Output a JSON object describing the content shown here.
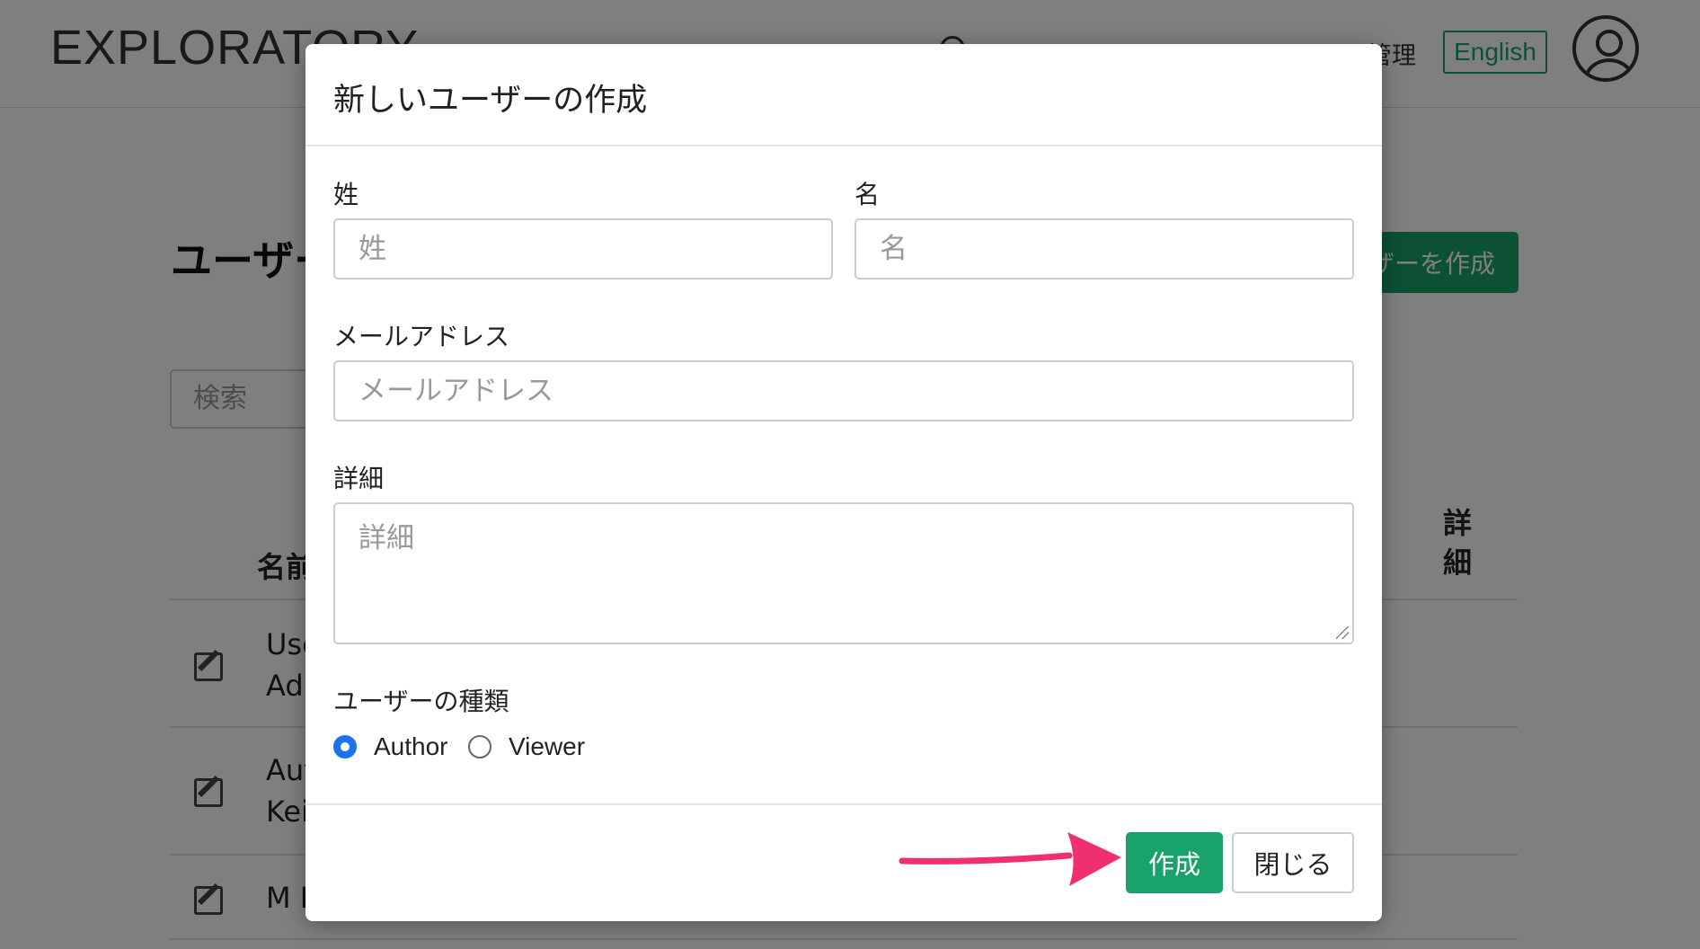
{
  "app": {
    "logo": "EXPLORATORY",
    "nav_partial": "管理",
    "language_button": "English",
    "page_title_partial": "ユーザー",
    "create_user_button_partial": "ザーを作成",
    "search_placeholder": "検索",
    "table": {
      "name_header_partial": "名前",
      "detail_header": "詳細",
      "rows": [
        {
          "line1": "Use",
          "line2": "Adr"
        },
        {
          "line1": "Aut",
          "line2": "Kei"
        },
        {
          "line1": "M I",
          "line2": ""
        }
      ]
    }
  },
  "modal": {
    "title": "新しいユーザーの作成",
    "last_name_label": "姓",
    "last_name_placeholder": "姓",
    "first_name_label": "名",
    "first_name_placeholder": "名",
    "email_label": "メールアドレス",
    "email_placeholder": "メールアドレス",
    "detail_label": "詳細",
    "detail_placeholder": "詳細",
    "user_type_label": "ユーザーの種類",
    "user_type_options": [
      "Author",
      "Viewer"
    ],
    "user_type_selected": "Author",
    "create_button": "作成",
    "close_button": "閉じる"
  },
  "colors": {
    "accent_green": "#1aa26b",
    "radio_blue": "#1a73e8",
    "annotation_arrow": "#f0306e"
  }
}
